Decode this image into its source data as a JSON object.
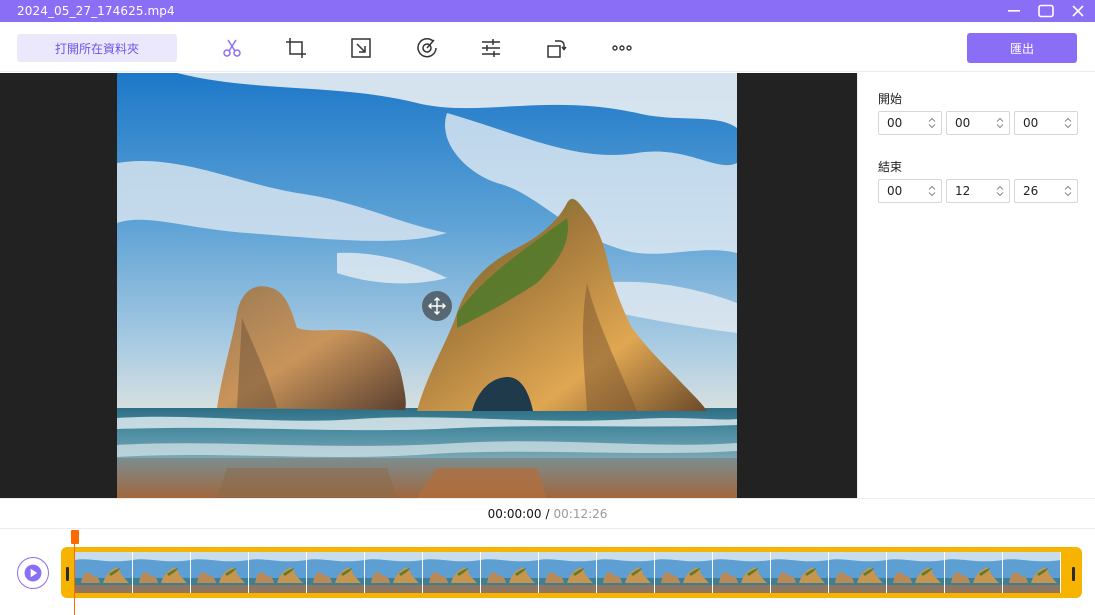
{
  "window": {
    "title": "2024_05_27_174625.mp4",
    "controls": [
      "minimize-icon",
      "maximize-icon",
      "close-icon"
    ]
  },
  "toolbar": {
    "open_folder_label": "打開所在資料夾",
    "tools": [
      "scissors-icon",
      "crop-icon",
      "resize-icon",
      "speed-icon",
      "adjust-icon",
      "rotate-icon",
      "more-icon"
    ],
    "export_label": "匯出"
  },
  "trim_panel": {
    "start_label": "開始",
    "start": {
      "hours": "00",
      "minutes": "00",
      "seconds": "00"
    },
    "end_label": "結束",
    "end": {
      "hours": "00",
      "minutes": "12",
      "seconds": "26"
    }
  },
  "playback": {
    "current_time": "00:00:00",
    "separator": "/",
    "total_time": "00:12:26"
  },
  "timeline": {
    "frame_count": 17,
    "playhead_progress": 0
  },
  "colors": {
    "accent": "#8a6ef5",
    "timeline_border": "#f6b400",
    "playhead": "#ff6a00"
  }
}
